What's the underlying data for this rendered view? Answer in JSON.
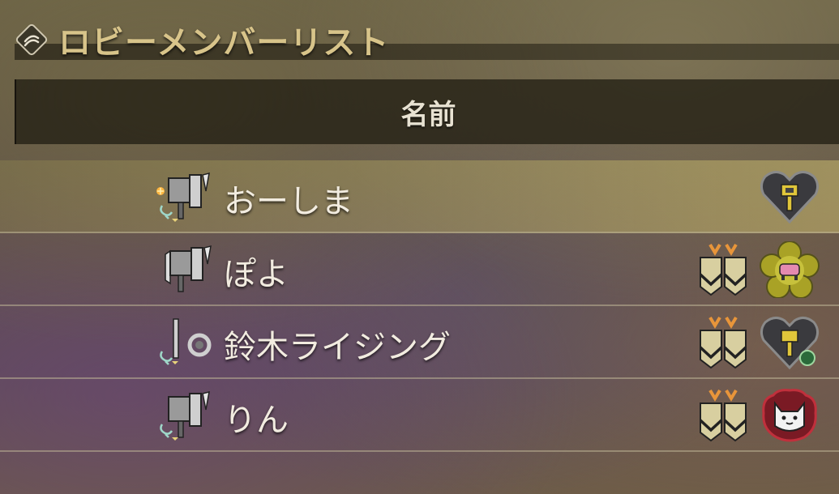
{
  "title": "ロビーメンバーリスト",
  "column_header": "名前",
  "members": [
    {
      "name": "おーしま",
      "weapon_icon": "greatsword-weapon-icon",
      "rank_icon": null,
      "badge_icon": "heart-hammer-badge-icon",
      "highlighted": true
    },
    {
      "name": "ぽよ",
      "weapon_icon": "greatsword-weapon-icon",
      "rank_icon": "hunter-rank-chevron-icon",
      "badge_icon": "flower-poogie-badge-icon",
      "highlighted": false
    },
    {
      "name": "鈴木ライジング",
      "weapon_icon": "insect-glaive-weapon-icon",
      "rank_icon": "hunter-rank-chevron-icon",
      "badge_icon": "heart-hammer-badge-icon",
      "highlighted": false
    },
    {
      "name": "りん",
      "weapon_icon": "greatsword-weapon-icon",
      "rank_icon": "hunter-rank-chevron-icon",
      "badge_icon": "palico-badge-icon",
      "highlighted": false
    }
  ],
  "colors": {
    "title": "#d8c48a",
    "highlight": "#c8b96e",
    "badge_dark": "#3a3a3e",
    "badge_red": "#7a1a24"
  }
}
